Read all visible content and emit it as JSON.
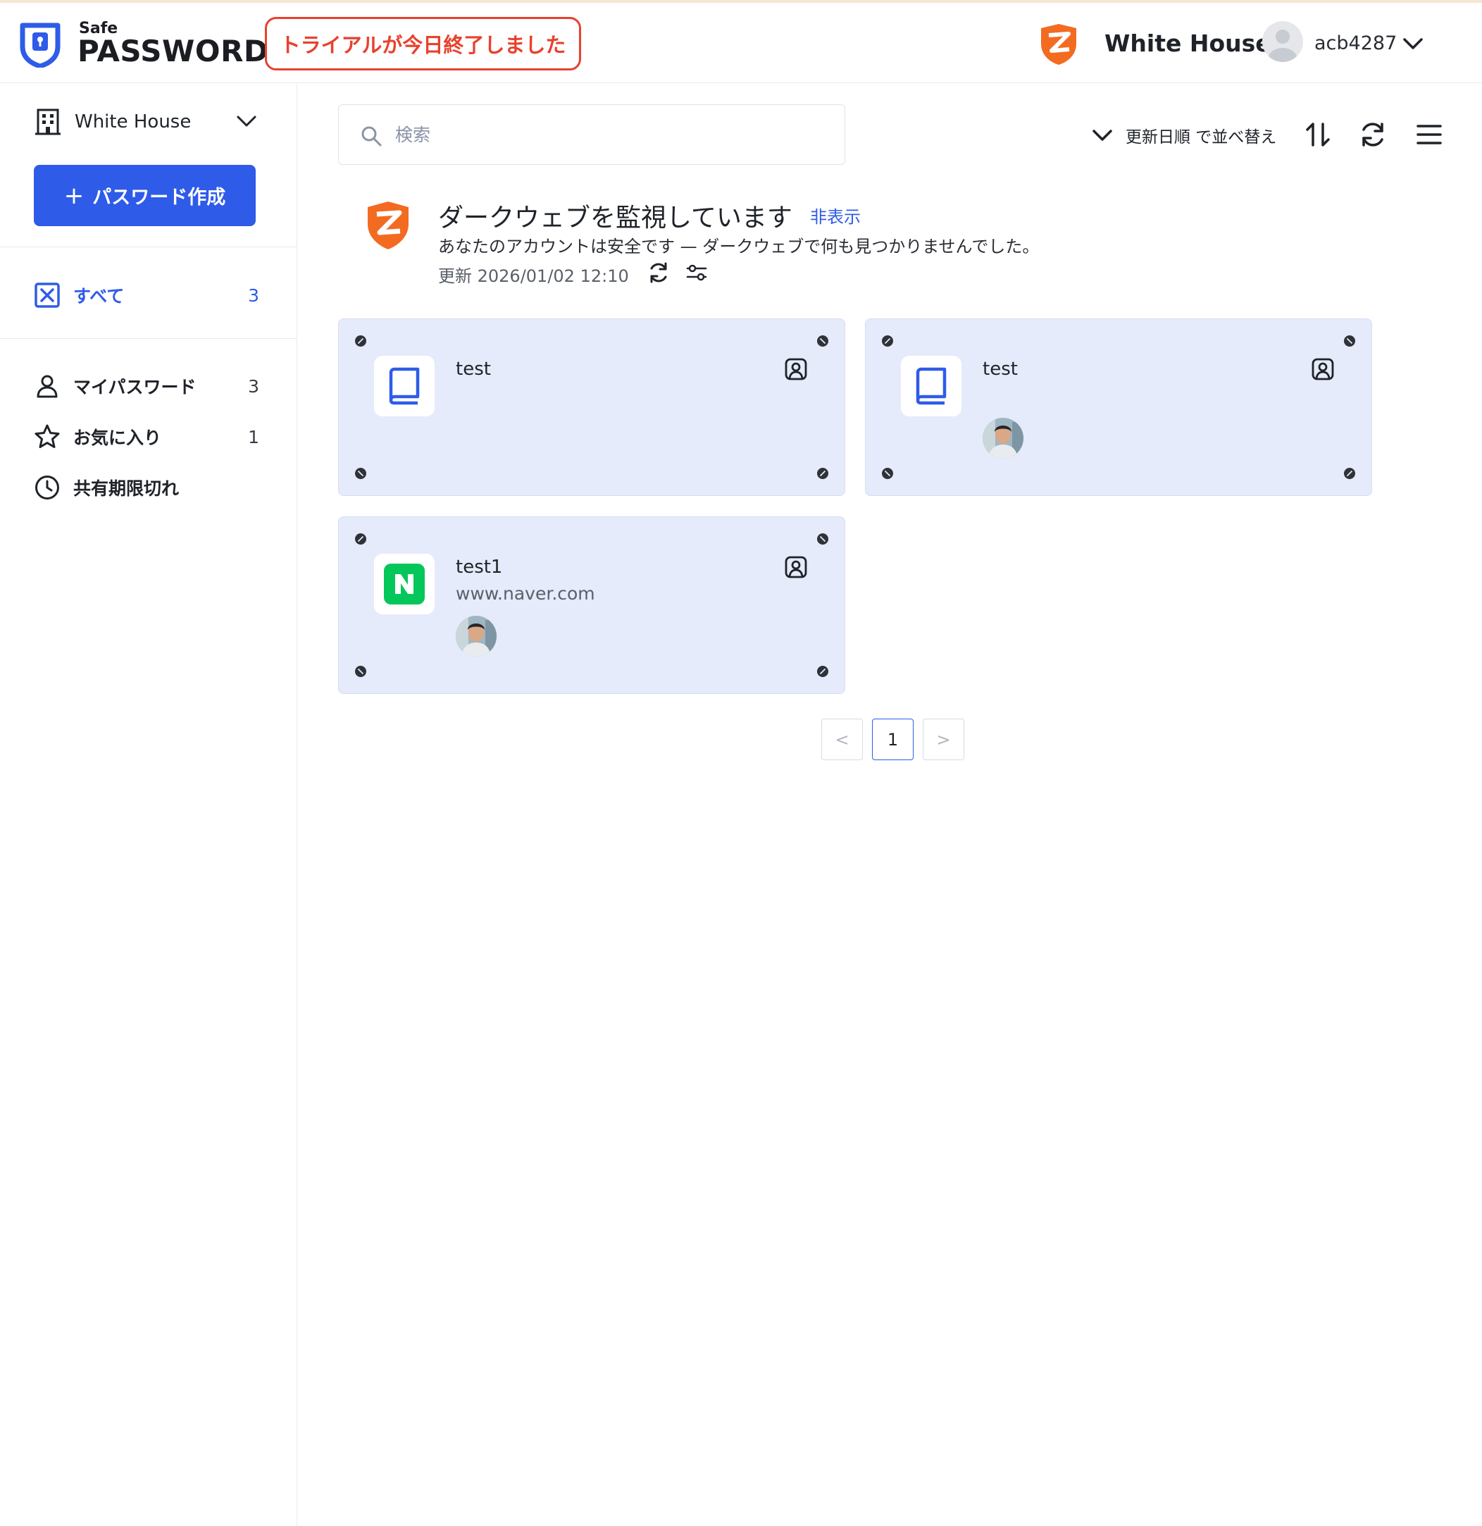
{
  "header": {
    "logo_small": "Safe",
    "logo_big": "PASSWORD",
    "trial_banner": "トライアルが今日終了しました",
    "org_name": "White House",
    "username": "acb4287"
  },
  "sidebar": {
    "org_selector": "White House",
    "create_button": "パスワード作成",
    "create_plus": "+",
    "all": {
      "label": "すべて",
      "count": "3"
    },
    "items": [
      {
        "label": "マイパスワード",
        "count": "3"
      },
      {
        "label": "お気に入り",
        "count": "1"
      },
      {
        "label": "共有期限切れ",
        "count": ""
      }
    ]
  },
  "toolbar": {
    "search_placeholder": "検索",
    "sort_label": "更新日順 で並べ替え"
  },
  "darkweb": {
    "title": "ダークウェブを監視しています",
    "hide_link": "非表示",
    "message": "あなたのアカウントは安全です — ダークウェブで何も見つかりませんでした。",
    "updated": "更新 2026/01/02 12:10"
  },
  "cards": [
    {
      "name": "test",
      "url": "",
      "icon": "book-icon"
    },
    {
      "name": "test",
      "url": "",
      "icon": "book-icon"
    },
    {
      "name": "test1",
      "url": "www.naver.com",
      "icon": "naver-icon"
    }
  ],
  "pagination": {
    "prev": "<",
    "current": "1",
    "next": ">"
  },
  "colors": {
    "accent": "#2f5be9",
    "trial_red": "#e8412e",
    "brand_orange": "#f36b21",
    "card_bg": "#e5ebfa",
    "naver_green": "#03c75a"
  }
}
